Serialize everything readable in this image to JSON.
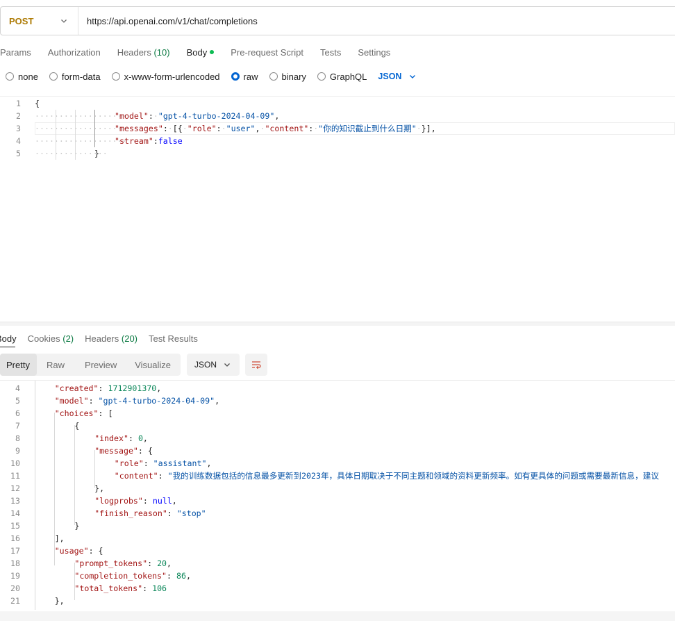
{
  "request": {
    "method": "POST",
    "url": "https://api.openai.com/v1/chat/completions"
  },
  "request_tabs": [
    {
      "label": "Params"
    },
    {
      "label": "Authorization"
    },
    {
      "label": "Headers",
      "count": "(10)"
    },
    {
      "label": "Body",
      "active": true,
      "dot": true
    },
    {
      "label": "Pre-request Script"
    },
    {
      "label": "Tests"
    },
    {
      "label": "Settings"
    }
  ],
  "body_types": [
    {
      "label": "none",
      "checked": false
    },
    {
      "label": "form-data",
      "checked": false
    },
    {
      "label": "x-www-form-urlencoded",
      "checked": false
    },
    {
      "label": "raw",
      "checked": true
    },
    {
      "label": "binary",
      "checked": false
    },
    {
      "label": "GraphQL",
      "checked": false
    }
  ],
  "body_format": "JSON",
  "request_body_lines": [
    {
      "n": "1",
      "indent": 0,
      "tokens": [
        [
          "p",
          "{"
        ]
      ]
    },
    {
      "n": "2",
      "indent": 1,
      "tokens": [
        [
          "k",
          "\"model\""
        ],
        [
          "p",
          ":"
        ],
        [
          "ws",
          "·"
        ],
        [
          "s",
          "\"gpt-4-turbo-2024-04-09\""
        ],
        [
          "p",
          ","
        ]
      ]
    },
    {
      "n": "3",
      "indent": 1,
      "tokens": [
        [
          "k",
          "\"messages\""
        ],
        [
          "p",
          ":"
        ],
        [
          "ws",
          "·"
        ],
        [
          "p",
          "[{"
        ],
        [
          "ws",
          "·"
        ],
        [
          "k",
          "\"role\""
        ],
        [
          "p",
          ":"
        ],
        [
          "ws",
          "·"
        ],
        [
          "s",
          "\"user\""
        ],
        [
          "p",
          ","
        ],
        [
          "ws",
          "·"
        ],
        [
          "k",
          "\"content\""
        ],
        [
          "p",
          ":"
        ],
        [
          "ws",
          "·"
        ],
        [
          "s",
          "\"你的知识截止到什么日期\""
        ],
        [
          "ws",
          "·"
        ],
        [
          "p",
          "}],"
        ]
      ]
    },
    {
      "n": "4",
      "indent": 1,
      "tokens": [
        [
          "k",
          "\"stream\""
        ],
        [
          "p",
          ":"
        ],
        [
          "kw",
          "false"
        ]
      ]
    },
    {
      "n": "5",
      "indent": 2,
      "tokens": [
        [
          "p",
          "}"
        ]
      ]
    }
  ],
  "response_tabs": [
    {
      "label": "Body",
      "active": true
    },
    {
      "label": "Cookies",
      "count": "(2)"
    },
    {
      "label": "Headers",
      "count": "(20)"
    },
    {
      "label": "Test Results"
    }
  ],
  "view_modes": [
    {
      "label": "Pretty",
      "active": true
    },
    {
      "label": "Raw"
    },
    {
      "label": "Preview"
    },
    {
      "label": "Visualize"
    }
  ],
  "response_format": "JSON",
  "response_lines": [
    {
      "n": "4",
      "indent": 1,
      "tokens": [
        [
          "k",
          "\"created\""
        ],
        [
          "p",
          ": "
        ],
        [
          "n",
          "1712901370"
        ],
        [
          "p",
          ","
        ]
      ]
    },
    {
      "n": "5",
      "indent": 1,
      "tokens": [
        [
          "k",
          "\"model\""
        ],
        [
          "p",
          ": "
        ],
        [
          "s",
          "\"gpt-4-turbo-2024-04-09\""
        ],
        [
          "p",
          ","
        ]
      ]
    },
    {
      "n": "6",
      "indent": 1,
      "tokens": [
        [
          "k",
          "\"choices\""
        ],
        [
          "p",
          ": ["
        ]
      ]
    },
    {
      "n": "7",
      "indent": 2,
      "tokens": [
        [
          "p",
          "{"
        ]
      ]
    },
    {
      "n": "8",
      "indent": 3,
      "tokens": [
        [
          "k",
          "\"index\""
        ],
        [
          "p",
          ": "
        ],
        [
          "n",
          "0"
        ],
        [
          "p",
          ","
        ]
      ]
    },
    {
      "n": "9",
      "indent": 3,
      "tokens": [
        [
          "k",
          "\"message\""
        ],
        [
          "p",
          ": {"
        ]
      ]
    },
    {
      "n": "10",
      "indent": 4,
      "tokens": [
        [
          "k",
          "\"role\""
        ],
        [
          "p",
          ": "
        ],
        [
          "s",
          "\"assistant\""
        ],
        [
          "p",
          ","
        ]
      ]
    },
    {
      "n": "11",
      "indent": 4,
      "tokens": [
        [
          "k",
          "\"content\""
        ],
        [
          "p",
          ": "
        ],
        [
          "s",
          "\"我的训练数据包括的信息最多更新到2023年，具体日期取决于不同主题和领域的资料更新频率。如有更具体的问题或需要最新信息，建议"
        ]
      ]
    },
    {
      "n": "12",
      "indent": 3,
      "tokens": [
        [
          "p",
          "},"
        ]
      ]
    },
    {
      "n": "13",
      "indent": 3,
      "tokens": [
        [
          "k",
          "\"logprobs\""
        ],
        [
          "p",
          ": "
        ],
        [
          "kw",
          "null"
        ],
        [
          "p",
          ","
        ]
      ]
    },
    {
      "n": "14",
      "indent": 3,
      "tokens": [
        [
          "k",
          "\"finish_reason\""
        ],
        [
          "p",
          ": "
        ],
        [
          "s",
          "\"stop\""
        ]
      ]
    },
    {
      "n": "15",
      "indent": 2,
      "tokens": [
        [
          "p",
          "}"
        ]
      ]
    },
    {
      "n": "16",
      "indent": 1,
      "tokens": [
        [
          "p",
          "],"
        ]
      ]
    },
    {
      "n": "17",
      "indent": 1,
      "tokens": [
        [
          "k",
          "\"usage\""
        ],
        [
          "p",
          ": {"
        ]
      ]
    },
    {
      "n": "18",
      "indent": 2,
      "tokens": [
        [
          "k",
          "\"prompt_tokens\""
        ],
        [
          "p",
          ": "
        ],
        [
          "n",
          "20"
        ],
        [
          "p",
          ","
        ]
      ]
    },
    {
      "n": "19",
      "indent": 2,
      "tokens": [
        [
          "k",
          "\"completion_tokens\""
        ],
        [
          "p",
          ": "
        ],
        [
          "n",
          "86"
        ],
        [
          "p",
          ","
        ]
      ]
    },
    {
      "n": "20",
      "indent": 2,
      "tokens": [
        [
          "k",
          "\"total_tokens\""
        ],
        [
          "p",
          ": "
        ],
        [
          "n",
          "106"
        ]
      ]
    },
    {
      "n": "21",
      "indent": 1,
      "tokens": [
        [
          "p",
          "},"
        ]
      ]
    }
  ]
}
